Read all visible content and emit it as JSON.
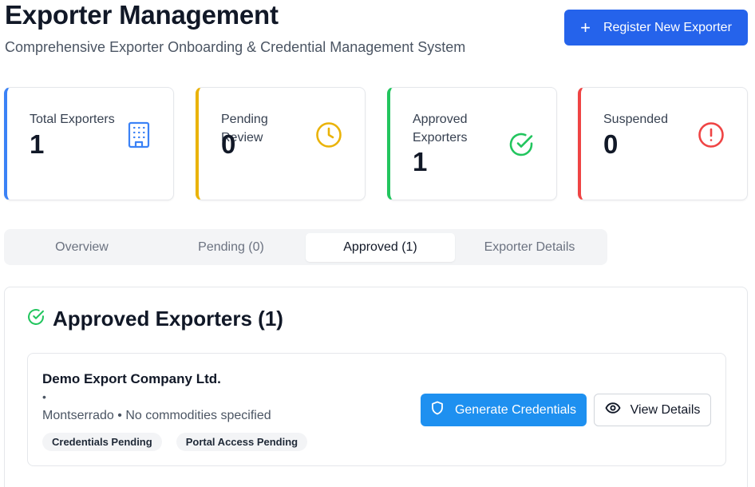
{
  "header": {
    "title": "Exporter Management",
    "subtitle": "Comprehensive Exporter Onboarding & Credential Management System",
    "register_button": {
      "label": "Register New Exporter",
      "icon": "plus-icon"
    }
  },
  "stats": [
    {
      "label": "Total Exporters",
      "value": "1",
      "icon": "building-icon",
      "color": "#3b82f6"
    },
    {
      "label": "Pending Review",
      "value": "0",
      "icon": "clock-icon",
      "color": "#eab308"
    },
    {
      "label": "Approved Exporters",
      "value": "1",
      "icon": "check-circle-icon",
      "color": "#22c55e"
    },
    {
      "label": "Suspended",
      "value": "0",
      "icon": "alert-circle-icon",
      "color": "#ef4444"
    }
  ],
  "tabs": [
    {
      "label": "Overview",
      "active": false
    },
    {
      "label": "Pending (0)",
      "active": false
    },
    {
      "label": "Approved (1)",
      "active": true
    },
    {
      "label": "Exporter Details",
      "active": false
    }
  ],
  "approved_panel": {
    "title": "Approved Exporters (1)",
    "icon": "check-circle-icon",
    "exporters": [
      {
        "name": "Demo Export Company Ltd.",
        "separator": "•",
        "location_commodities": "Montserrado • No commodities specified",
        "badges": [
          "Credentials Pending",
          "Portal Access Pending"
        ],
        "generate_button": {
          "label": "Generate Credentials",
          "icon": "shield-icon"
        },
        "view_button": {
          "label": "View Details",
          "icon": "eye-icon"
        }
      }
    ]
  },
  "colors": {
    "primary": "#2563eb",
    "generate": "#1e90f0"
  }
}
